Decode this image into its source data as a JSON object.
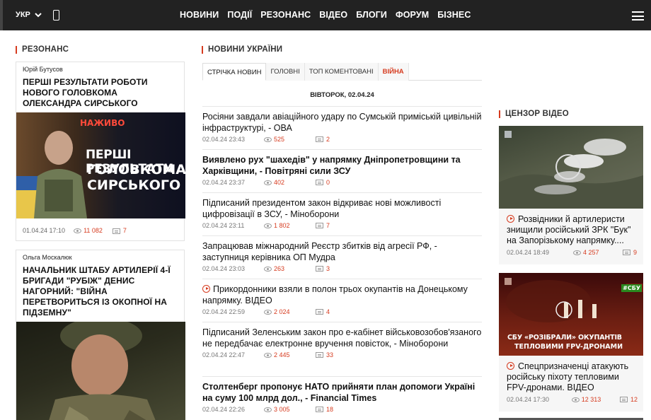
{
  "header": {
    "lang": "УКР",
    "nav": [
      "НОВИНИ",
      "ПОДІЇ",
      "РЕЗОНАНС",
      "ВІДЕО",
      "БЛОГИ",
      "ФОРУМ",
      "БІЗНЕС"
    ]
  },
  "resonance": {
    "heading": "РЕЗОНАНС",
    "cards": [
      {
        "author": "Юрій Бутусов",
        "title": "ПЕРШІ РЕЗУЛЬТАТИ РОБОТИ НОВОГО ГОЛОВКОМА ОЛЕКСАНДРА СИРСЬКОГО",
        "img_badge": "НАЖИВО",
        "img_text_1": "ПЕРШІ РЕЗУЛЬТАТИ",
        "img_text_2": "ГОЛОВКОМА",
        "img_text_3": "СИРСЬКОГО",
        "date": "01.04.24 17:10",
        "views": "11 082",
        "comments": "7"
      },
      {
        "author": "Ольга Москалюк",
        "title": "НАЧАЛЬНИК ШТАБУ АРТИЛЕРІЇ 4-Ї БРИГАДИ \"РУБІЖ\" ДЕНИС НАГОРНИЙ: \"ВІЙНА ПЕРЕТВОРИТЬСЯ ІЗ ОКОПНОЇ НА ПІДЗЕМНУ\""
      }
    ]
  },
  "ukraine_news": {
    "heading": "НОВИНИ УКРАЇНИ",
    "tabs": [
      "СТРІЧКА НОВИН",
      "ГОЛОВНІ",
      "ТОП КОМЕНТОВАНІ",
      "ВІЙНА"
    ],
    "date": "ВІВТОРОК, 02.04.24",
    "items": [
      {
        "title": "Росіяни завдали авіаційного удару по Сумській приміській цивільній інфраструктурі, - ОВА",
        "time": "02.04.24 23:43",
        "views": "525",
        "comments": "2",
        "bold": false
      },
      {
        "title": "Виявлено рух \"шахедів\" у напрямку Дніпропетровщини та Харківщини, - Повітряні сили ЗСУ",
        "time": "02.04.24 23:37",
        "views": "402",
        "comments": "0",
        "bold": true
      },
      {
        "title": "Підписаний президентом закон відкриває нові можливості цифровізації в ЗСУ, - Міноборони",
        "time": "02.04.24 23:11",
        "views": "1 802",
        "comments": "7",
        "bold": false
      },
      {
        "title": "Запрацював міжнародний Реєстр збитків від агресії РФ, - заступниця керівника ОП Мудра",
        "time": "02.04.24 23:03",
        "views": "263",
        "comments": "3",
        "bold": false
      },
      {
        "title": "Прикордонники взяли в полон трьох окупантів на Донецькому напрямку. ВІДЕО",
        "time": "02.04.24 22:59",
        "views": "2 024",
        "comments": "4",
        "bold": false,
        "video": true
      },
      {
        "title": "Підписаний Зеленським закон про е-кабінет військовозобов'язаного не передбачає електронне вручення повісток, - Міноборони",
        "time": "02.04.24 22:47",
        "views": "2 445",
        "comments": "33",
        "bold": false
      },
      {
        "title": "Столтенберг пропонує НАТО прийняти план допомоги Україні на суму 100 млрд дол., - Financial Times",
        "time": "02.04.24 22:26",
        "views": "3 005",
        "comments": "18",
        "bold": true
      }
    ]
  },
  "censor_video": {
    "heading": "ЦЕНЗОР ВІДЕО",
    "cards": [
      {
        "title": "Розвідники й артилеристи знищили російський ЗРК \"Бук\" на Запорізькому напрямку....",
        "time": "02.04.24 18:49",
        "views": "4 257",
        "comments": "9"
      },
      {
        "title": "Спецпризначенці атакують російську піхоту тепловими FPV-дронами. ВІДЕО",
        "time": "02.04.24 17:30",
        "views": "12 313",
        "comments": "12",
        "img_badge": "#СБУ",
        "img_text_1": "СБУ «РОЗІБРАЛИ» ОКУПАНТІВ",
        "img_text_2": "ТЕПЛОВИМИ FPV-ДРОНАМИ"
      }
    ]
  }
}
